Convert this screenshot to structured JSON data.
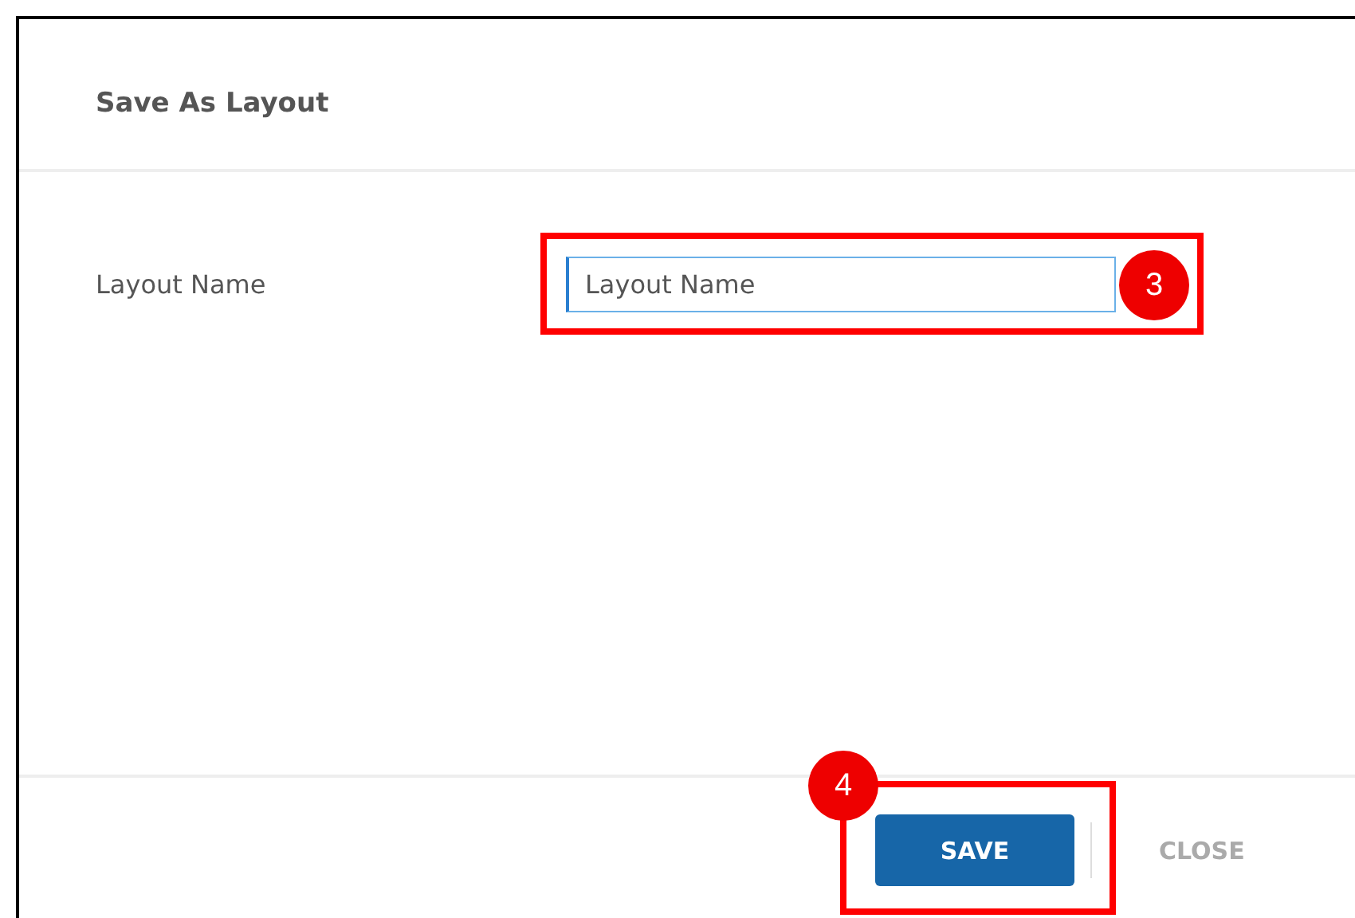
{
  "dialog": {
    "title": "Save As Layout"
  },
  "field": {
    "label": "Layout Name",
    "placeholder": "Layout Name",
    "focused": true,
    "step": "3"
  },
  "buttons": [
    {
      "kind": "primary",
      "label": "SAVE",
      "step": "4"
    },
    {
      "kind": "secondary",
      "label": "CLOSE"
    }
  ]
}
